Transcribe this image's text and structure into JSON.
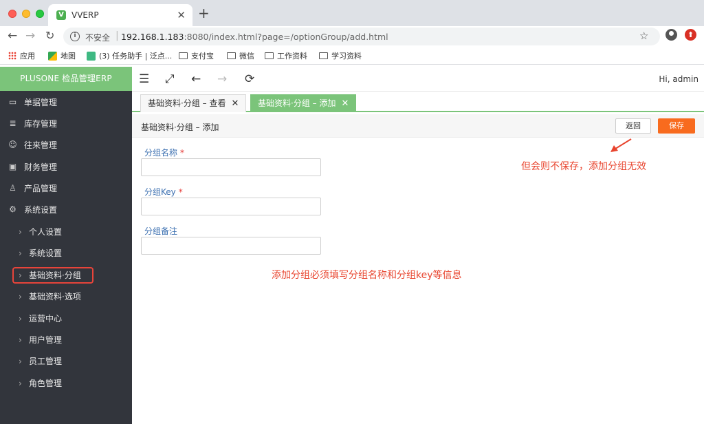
{
  "browser": {
    "tab_title": "VVERP",
    "favicon_letter": "V",
    "insecure_label": "不安全",
    "url_host": "192.168.1.183",
    "url_rest": ":8080/index.html?page=/optionGroup/add.html",
    "bookmarks": [
      "应用",
      "地图",
      "(3) 任务助手 | 泛点...",
      "支付宝",
      "微信",
      "工作资料",
      "学习资料"
    ]
  },
  "sidebar": {
    "brand": "PLUSONE 检品管理ERP",
    "menu": [
      {
        "label": "单据管理",
        "icon": "monitor-icon"
      },
      {
        "label": "库存管理",
        "icon": "database-icon"
      },
      {
        "label": "往来管理",
        "icon": "user-icon"
      },
      {
        "label": "财务管理",
        "icon": "wallet-icon"
      },
      {
        "label": "产品管理",
        "icon": "product-icon"
      },
      {
        "label": "系统设置",
        "icon": "gear-icon"
      }
    ],
    "submenu": [
      "个人设置",
      "系统设置",
      "基础资料·分组",
      "基础资料·选项",
      "运营中心",
      "用户管理",
      "员工管理",
      "角色管理"
    ]
  },
  "app_toolbar": {
    "greeting": "Hi, admin"
  },
  "tabs": [
    {
      "label": "基础资料·分组 – 查看"
    },
    {
      "label": "基础资料·分组 – 添加"
    }
  ],
  "content": {
    "title": "基础资料·分组 – 添加",
    "back_label": "返回",
    "save_label": "保存"
  },
  "form": {
    "group_name_label": "分组名称",
    "group_key_label": "分组Key",
    "group_remark_label": "分组备注",
    "required_mark": "*",
    "group_name_value": "",
    "group_key_value": "",
    "group_remark_value": ""
  },
  "annotations": {
    "note_top": "但会则不保存，添加分组无效",
    "note_middle": "添加分组必须填写分组名称和分组key等信息",
    "color": "#e8442e"
  },
  "colors": {
    "brand_green": "#7bc47a",
    "sidebar_bg": "#32353c",
    "save_orange": "#f86b1e",
    "label_blue": "#3b6fb0"
  }
}
